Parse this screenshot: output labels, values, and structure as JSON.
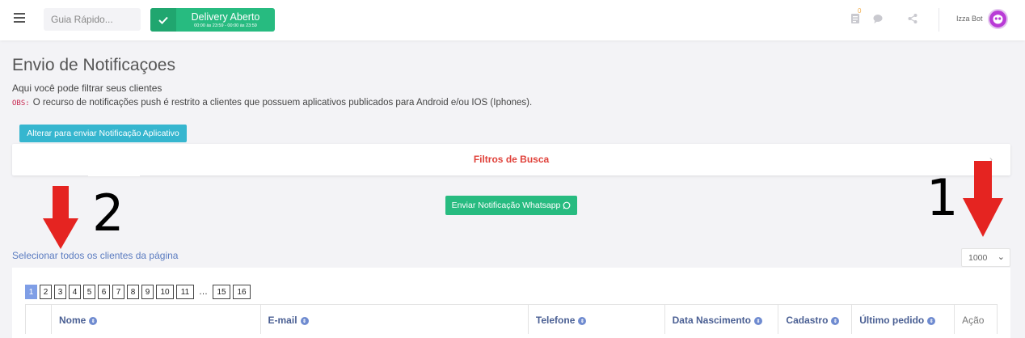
{
  "topbar": {
    "quick_placeholder": "Guia Rápido...",
    "delivery_label": "Delivery Aberto",
    "delivery_hours": "00:00 às 23:59 - 00:00 às 23:59",
    "notif_badge": "0",
    "user_name": "Izza Bot"
  },
  "page": {
    "title": "Envio de Notificaçoes",
    "subtitle": "Aqui você pode filtrar seus clientes",
    "obs_code": "OBS:",
    "obs_text": "O recurso de notificações push é restrito a clientes que possuem aplicativos publicados para Android e/ou IOS (Iphones).",
    "switch_button": "Alterar para enviar Notificação Aplicativo",
    "filters_label": "Filtros de Busca",
    "whatsapp_button": "Enviar Notificação Whatsapp",
    "select_all": "Selecionar todos os clientes da página",
    "page_size": "1000"
  },
  "pagination": [
    "1",
    "2",
    "3",
    "4",
    "5",
    "6",
    "7",
    "8",
    "9",
    "10",
    "11",
    "…",
    "15",
    "16"
  ],
  "table": {
    "columns": [
      "Nome",
      "E-mail",
      "Telefone",
      "Data Nascimento",
      "Cadastro",
      "Último pedido",
      "Ação"
    ]
  },
  "annotations": {
    "label_1": "1",
    "label_2": "2",
    "arrow_color": "#e52421"
  },
  "colors": {
    "green": "#27bb80",
    "teal": "#36b6cf",
    "red_text": "#e0413a",
    "link_blue": "#5a7bc0"
  }
}
